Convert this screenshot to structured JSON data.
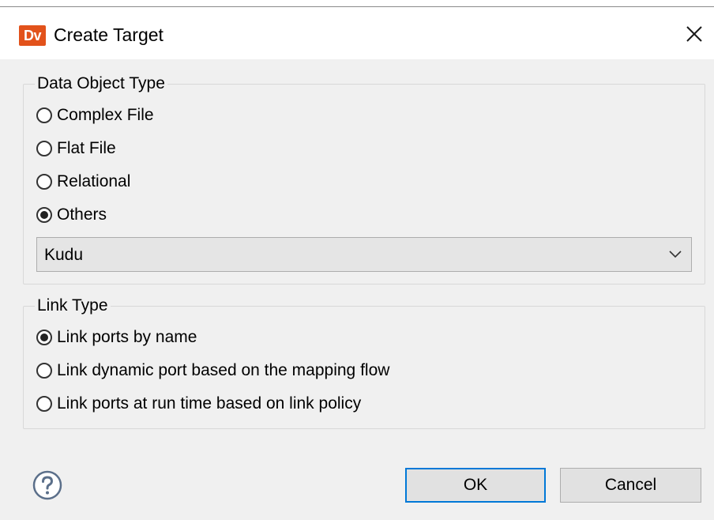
{
  "dialog": {
    "title": "Create Target",
    "app_icon_text": "Dv",
    "app_icon_color": "#e2521b"
  },
  "data_object_type": {
    "legend": "Data Object Type",
    "options": [
      {
        "label": "Complex File",
        "checked": false
      },
      {
        "label": "Flat File",
        "checked": false
      },
      {
        "label": "Relational",
        "checked": false
      },
      {
        "label": "Others",
        "checked": true
      }
    ],
    "others_select_value": "Kudu"
  },
  "link_type": {
    "legend": "Link Type",
    "options": [
      {
        "label": "Link ports by name",
        "checked": true
      },
      {
        "label": "Link dynamic port based on the mapping flow",
        "checked": false
      },
      {
        "label": "Link ports at run time based on link policy",
        "checked": false
      }
    ]
  },
  "footer": {
    "ok_label": "OK",
    "cancel_label": "Cancel",
    "help_icon": "question-circle-icon",
    "accent_color": "#0078d7"
  }
}
